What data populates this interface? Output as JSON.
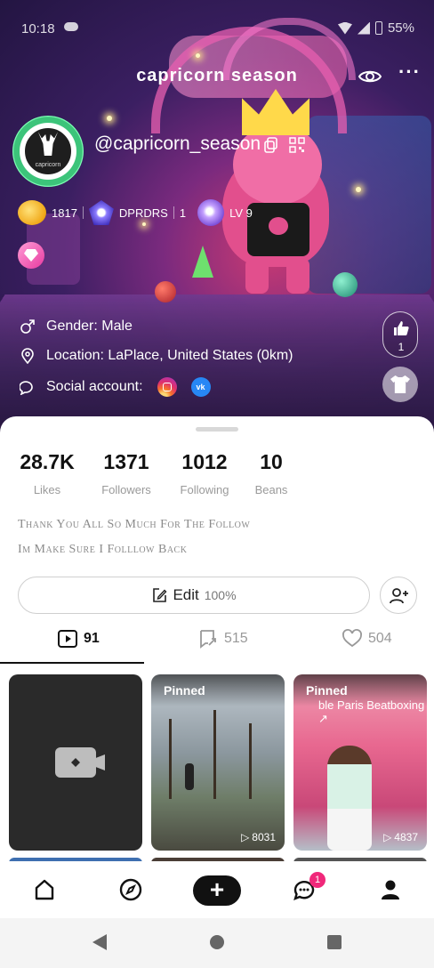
{
  "status_bar": {
    "time": "10:18",
    "battery": "55%"
  },
  "header": {
    "title": "capricorn season"
  },
  "profile": {
    "handle": "@capricorn_season",
    "avatar_caption": "capricorn",
    "badges": [
      {
        "icon": "coin-icon",
        "text": "1817"
      },
      {
        "icon": "gem-icon",
        "text": "DPRDRS"
      },
      {
        "icon": "",
        "text": "1"
      },
      {
        "icon": "level-orb-icon",
        "text": "LV 9"
      }
    ],
    "gender": "Gender: Male",
    "location": "Location: LaPlace, United States (0km)",
    "social": "Social account:",
    "like_count": "1"
  },
  "stats": [
    {
      "value": "28.7K",
      "label": "Likes"
    },
    {
      "value": "1371",
      "label": "Followers"
    },
    {
      "value": "1012",
      "label": "Following"
    },
    {
      "value": "10",
      "label": "Beans"
    }
  ],
  "bio": [
    "Thank You All So Much For The Follow",
    "Im Make Sure I Folllow Back"
  ],
  "edit": {
    "label": "Edit",
    "percent": "100%"
  },
  "tabs": [
    {
      "icon": "video-icon",
      "count": "91"
    },
    {
      "icon": "repost-icon",
      "count": "515"
    },
    {
      "icon": "heart-icon",
      "count": "504"
    }
  ],
  "videos": [
    {
      "pinned": "",
      "subtitle": "",
      "views": ""
    },
    {
      "pinned": "Pinned",
      "subtitle": "",
      "views": "8031"
    },
    {
      "pinned": "Pinned",
      "subtitle": "ble Paris Beatboxing ↗",
      "views": "4837"
    }
  ],
  "nav": {
    "messages_badge": "1"
  },
  "colors": {
    "accent": "#f0287a",
    "text": "#111111",
    "muted": "#9a9a9a"
  }
}
